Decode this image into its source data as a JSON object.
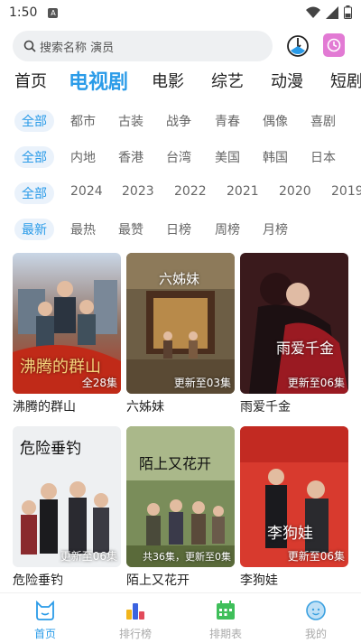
{
  "status": {
    "time": "1:50",
    "indicator": "A"
  },
  "search": {
    "placeholder": "搜索名称 演员"
  },
  "tabs": [
    {
      "label": "首页",
      "active": false
    },
    {
      "label": "电视剧",
      "active": true
    },
    {
      "label": "电影",
      "active": false
    },
    {
      "label": "综艺",
      "active": false
    },
    {
      "label": "动漫",
      "active": false
    },
    {
      "label": "短剧",
      "active": false
    }
  ],
  "filters": {
    "genre": [
      "全部",
      "都市",
      "古装",
      "战争",
      "青春",
      "偶像",
      "喜剧"
    ],
    "region": [
      "全部",
      "内地",
      "香港",
      "台湾",
      "美国",
      "韩国",
      "日本"
    ],
    "year": [
      "全部",
      "2024",
      "2023",
      "2022",
      "2021",
      "2020",
      "2019"
    ],
    "sort": [
      "最新",
      "最热",
      "最赞",
      "日榜",
      "周榜",
      "月榜"
    ]
  },
  "cards": [
    {
      "title": "沸腾的群山",
      "badge": "全28集",
      "poster_text": "沸腾的群山"
    },
    {
      "title": "六姊妹",
      "badge": "更新至03集",
      "poster_text": "六姊妹"
    },
    {
      "title": "雨爱千金",
      "badge": "更新至06集",
      "poster_text": "雨爱千金"
    },
    {
      "title": "危险垂钓",
      "badge": "更新至06集",
      "poster_text": "危险垂钓"
    },
    {
      "title": "陌上又花开",
      "badge": "共36集，更新至0集",
      "poster_text": "陌上又花开"
    },
    {
      "title": "李狗娃",
      "badge": "更新至06集",
      "poster_text": "李狗娃"
    }
  ],
  "nav": [
    {
      "label": "首页",
      "icon": "home-cat-icon",
      "active": true
    },
    {
      "label": "排行榜",
      "icon": "ranking-icon",
      "active": false
    },
    {
      "label": "排期表",
      "icon": "calendar-icon",
      "active": false
    },
    {
      "label": "我的",
      "icon": "profile-icon",
      "active": false
    }
  ],
  "colors": {
    "accent": "#2a9be8",
    "chip_bg": "#eaf2fb",
    "clock_button": "#e27ad4"
  }
}
